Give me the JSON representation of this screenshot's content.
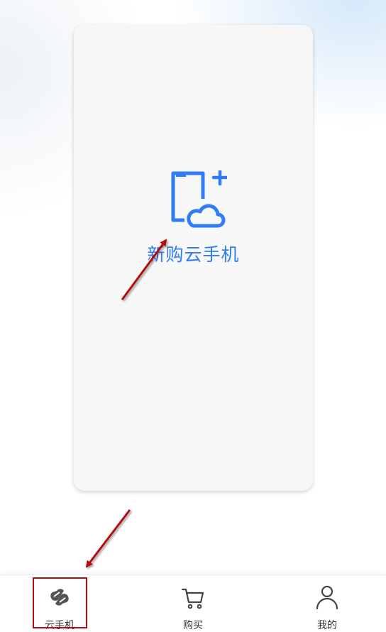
{
  "main": {
    "new_phone_label": "新购云手机",
    "icon": "cloud-phone-plus-icon"
  },
  "tabbar": {
    "tabs": [
      {
        "label": "云手机",
        "icon": "cloud-phone-icon",
        "selected": true
      },
      {
        "label": "购买",
        "icon": "cart-icon",
        "selected": false
      },
      {
        "label": "我的",
        "icon": "person-icon",
        "selected": false
      }
    ]
  },
  "colors": {
    "accent": "#2e7cf6",
    "annotation": "#b30f0f",
    "tab_text": "#333333",
    "card_bg": "#f7f7f7"
  }
}
